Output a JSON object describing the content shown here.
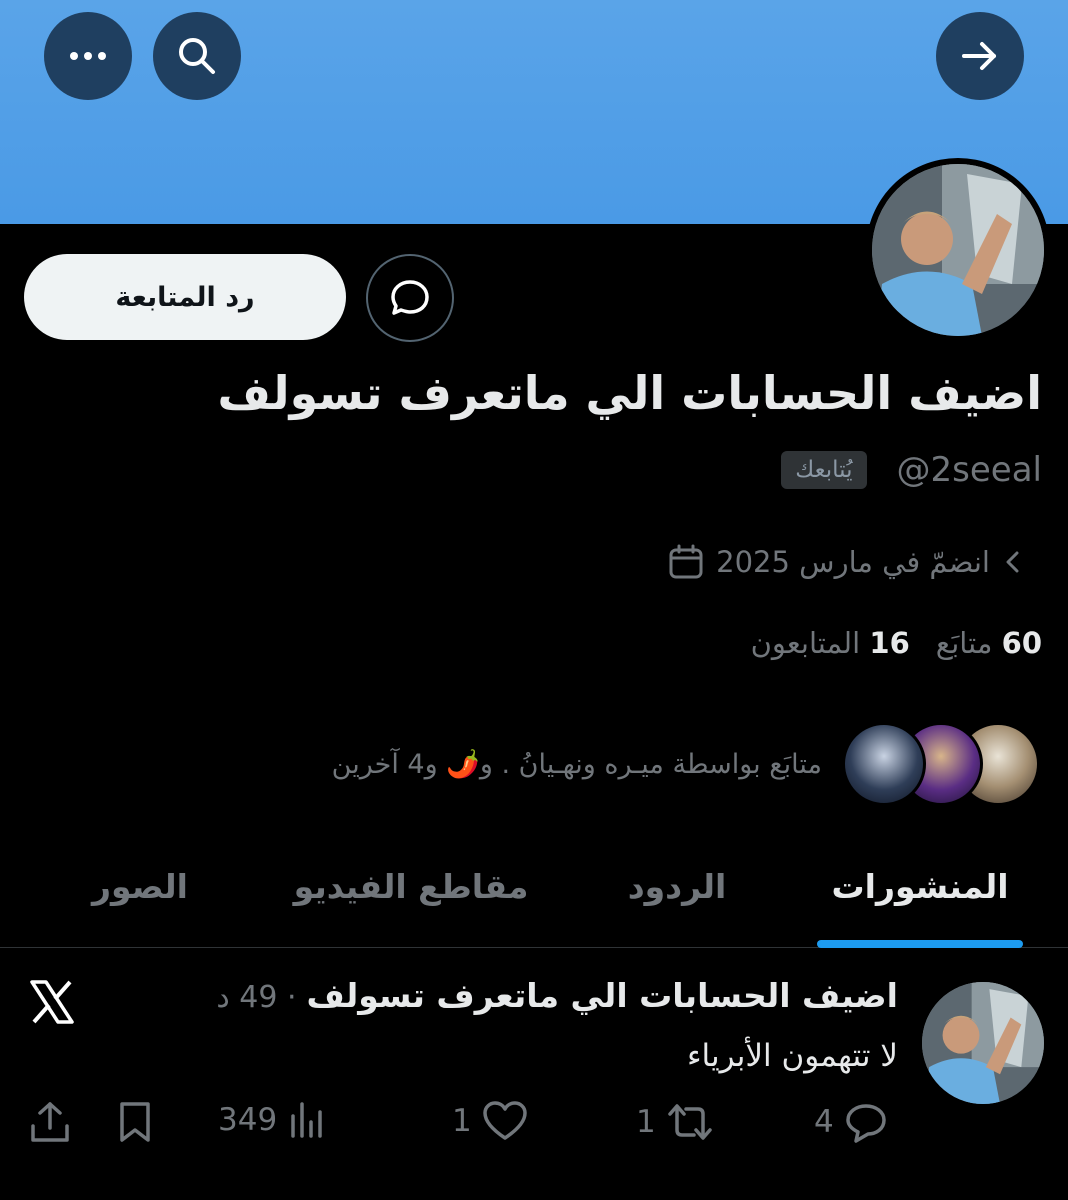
{
  "header": {
    "back_icon": "arrow-right-icon",
    "search_icon": "search-icon",
    "more_icon": "more-horizontal-icon",
    "banner_color": "#4a9ae6"
  },
  "profile": {
    "display_name": "اضيف الحسابات الي ماتعرف تسولف",
    "handle": "@2seeal",
    "follows_you_badge": "يُتابعك",
    "follow_back_label": "رد المتابعة",
    "joined": "انضمّ في مارس 2025",
    "following_count": "60",
    "following_label": "متابَع",
    "followers_count": "16",
    "followers_label": "المتابعون",
    "mutual_text": "متابَع بواسطة ميـره ونهـيانُ . و🌶️ و4 آخرين"
  },
  "tabs": [
    {
      "label": "المنشورات",
      "active": true
    },
    {
      "label": "الردود",
      "active": false
    },
    {
      "label": "مقاطع الفيديو",
      "active": false
    },
    {
      "label": "الصور",
      "active": false
    }
  ],
  "post": {
    "author": "اضيف الحسابات الي ماتعرف تسولف",
    "time": "· 49 د",
    "text": "لا تتهمون الأبرياء",
    "replies": "4",
    "reposts": "1",
    "likes": "1",
    "views": "349"
  },
  "colors": {
    "accent": "#1d9bf0",
    "muted": "#71767b",
    "background": "#000000"
  }
}
